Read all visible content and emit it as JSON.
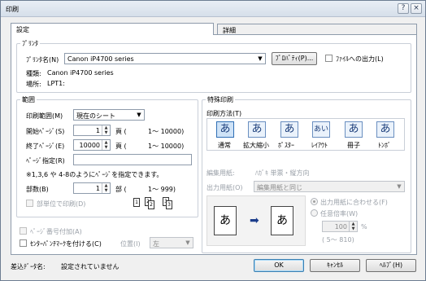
{
  "window": {
    "title": "印刷",
    "help_glyph": "?",
    "close_glyph": "×"
  },
  "tabs": [
    {
      "label": "設定"
    },
    {
      "label": "詳細"
    }
  ],
  "printer": {
    "group_label": "ﾌﾟﾘﾝﾀ",
    "name_label": "ﾌﾟﾘﾝﾀ名(N)",
    "name_value": "Canon iP4700 series",
    "properties_label": "ﾌﾟﾛﾊﾟﾃｨ(P)...",
    "file_output_label": "ﾌｧｲﾙへの出力(L)",
    "type_label": "種類:",
    "type_value": "Canon iP4700 series",
    "location_label": "場所:",
    "location_value": "LPT1:"
  },
  "range": {
    "group_label": "範囲",
    "print_range_label": "印刷範囲(M)",
    "print_range_value": "現在のシート",
    "start_label": "開始ﾍﾟｰｼﾞ(S)",
    "start_value": "1",
    "start_unit": "頁 (",
    "start_limit": "1〜 10000)",
    "end_label": "終了ﾍﾟｰｼﾞ(E)",
    "end_value": "10000",
    "end_unit": "頁 (",
    "end_limit": "1〜 10000)",
    "page_spec_label": "ﾍﾟｰｼﾞ指定(R)",
    "page_spec_value": "",
    "note": "※1,3,6 や 4-8のようにﾍﾟｰｼﾞを指定できます。",
    "copies_label": "部数(B)",
    "copies_value": "1",
    "copies_unit": "部 (",
    "copies_limit": "1〜   999)",
    "collate_label": "部単位で印刷(D)"
  },
  "collate_pages": [
    "1",
    "2",
    "3"
  ],
  "options": {
    "page_number_label": "ﾍﾟｰｼﾞ番号付加(A)",
    "center_punch_label": "ｾﾝﾀｰﾊﾟﾝﾁﾏｰｸを付ける(C)",
    "position_label": "位置(I)",
    "position_value": "左"
  },
  "special": {
    "group_label": "特殊印刷",
    "method_label": "印刷方法(T)",
    "modes": [
      {
        "label": "通常",
        "icon": "あ"
      },
      {
        "label": "拡大縮小",
        "icon": "あ"
      },
      {
        "label": "ﾎﾟｽﾀｰ",
        "icon": "あ"
      },
      {
        "label": "ﾚｲｱｳﾄ",
        "icon": "あい"
      },
      {
        "label": "冊子",
        "icon": "あ"
      },
      {
        "label": "ﾄﾝﾎﾞ",
        "icon": "あ"
      }
    ],
    "edit_paper_label": "編集用紙:",
    "edit_paper_value": "ﾊｶﾞｷ 単票・縦方向",
    "output_paper_label": "出力用紙(O)",
    "output_paper_value": "編集用紙と同じ",
    "preview_from": "あ",
    "preview_to": "あ",
    "fit_label": "出力用紙に合わせる(F)",
    "scale_label": "任意倍率(W)",
    "scale_value": "100",
    "scale_unit": "%",
    "scale_range": "(   5〜  810)"
  },
  "footer": {
    "spool_label": "差込ﾃﾞｰﾀ名:",
    "spool_value": "設定されていません",
    "ok": "OK",
    "cancel": "ｷｬﾝｾﾙ",
    "help": "ﾍﾙﾌﾟ(H)"
  }
}
